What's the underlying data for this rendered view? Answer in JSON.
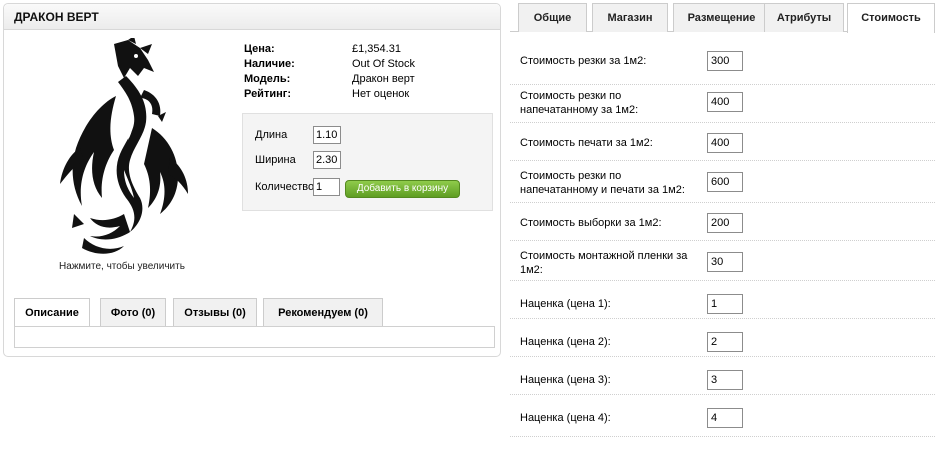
{
  "product": {
    "title": "ДРАКОН ВЕРТ",
    "image_caption": "Нажмите, чтобы увеличить",
    "info": [
      {
        "label": "Цена:",
        "value": "£1,354.31"
      },
      {
        "label": "Наличие:",
        "value": "Out Of Stock"
      },
      {
        "label": "Модель:",
        "value": "Дракон верт"
      },
      {
        "label": "Рейтинг:",
        "value": "Нет оценок"
      }
    ],
    "cart": {
      "length_label": "Длина",
      "length_value": "1.10",
      "width_label": "Ширина",
      "width_value": "2.30",
      "quantity_label": "Количество:",
      "quantity_value": "1",
      "add_button": "Добавить в корзину"
    },
    "tabs": [
      "Описание",
      "Фото (0)",
      "Отзывы (0)",
      "Рекомендуем (0)"
    ]
  },
  "admin": {
    "tabs": [
      "Общие",
      "Магазин",
      "Размещение",
      "Атрибуты",
      "Стоимость"
    ],
    "active_tab": "Стоимость",
    "fields": [
      {
        "label": "Стоимость резки за 1м2:",
        "value": "300"
      },
      {
        "label": "Стоимость резки по напечатанному за 1м2:",
        "value": "400"
      },
      {
        "label": "Стоимость печати за 1м2:",
        "value": "400"
      },
      {
        "label": "Стоимость резки по напечатанному и печати за 1м2:",
        "value": "600"
      },
      {
        "label": "Стоимость выборки за 1м2:",
        "value": "200"
      },
      {
        "label": "Стоимость монтажной пленки за 1м2:",
        "value": "30"
      },
      {
        "label": "Наценка (цена 1):",
        "value": "1"
      },
      {
        "label": "Наценка (цена 2):",
        "value": "2"
      },
      {
        "label": "Наценка (цена 3):",
        "value": "3"
      },
      {
        "label": "Наценка (цена 4):",
        "value": "4"
      }
    ]
  }
}
